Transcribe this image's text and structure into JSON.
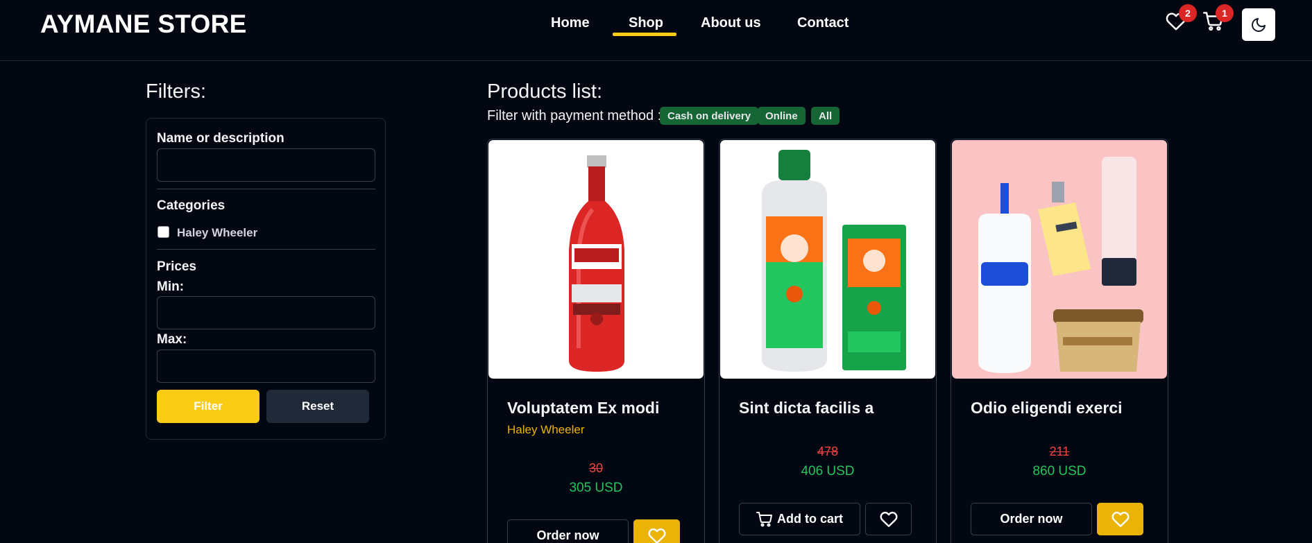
{
  "header": {
    "brand": "AYMANE STORE",
    "nav": [
      {
        "label": "Home",
        "active": false
      },
      {
        "label": "Shop",
        "active": true
      },
      {
        "label": "About us",
        "active": false
      },
      {
        "label": "Contact",
        "active": false
      }
    ],
    "wishlist_count": "2",
    "cart_count": "1",
    "icons": {
      "wishlist": "heart-icon",
      "cart": "cart-icon",
      "theme": "moon-icon"
    },
    "accent_color": "#facc15",
    "badge_color": "#dc2626"
  },
  "filters": {
    "title": "Filters:",
    "name_label": "Name or description",
    "name_value": "",
    "categories_label": "Categories",
    "categories": [
      {
        "label": "Haley Wheeler",
        "checked": false
      }
    ],
    "prices_label": "Prices",
    "min_label": "Min:",
    "min_value": "",
    "max_label": "Max:",
    "max_value": "",
    "filter_button": "Filter",
    "reset_button": "Reset"
  },
  "products": {
    "title": "Products list:",
    "payment_label": "Filter with payment method :",
    "payment_methods": [
      "Cash on delivery",
      "Online",
      "All"
    ],
    "items": [
      {
        "title": "Voluptatem Ex modi",
        "category": "Haley Wheeler",
        "old_price": "30",
        "new_price": "305 USD",
        "primary_button": "Order now",
        "image_desc": "red-vodka-bottle",
        "wishlisted": true
      },
      {
        "title": "Sint dicta facilis a",
        "category": "",
        "old_price": "478",
        "new_price": "406 USD",
        "primary_button": "Add to cart",
        "image_desc": "insect-repellent-bottle",
        "wishlisted": false
      },
      {
        "title": "Odio eligendi exerci",
        "category": "",
        "old_price": "211",
        "new_price": "860 USD",
        "primary_button": "Order now",
        "image_desc": "skincare-products",
        "wishlisted": true
      }
    ]
  }
}
